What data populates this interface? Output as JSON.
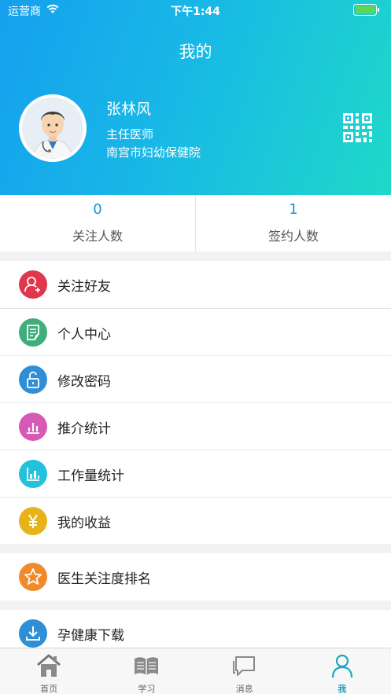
{
  "status_bar": {
    "carrier": "运营商",
    "time": "下午1:44"
  },
  "header": {
    "title": "我的"
  },
  "profile": {
    "name": "张林风",
    "title": "主任医师",
    "organization": "南宫市妇幼保健院",
    "avatar_icon": "doctor-avatar-icon",
    "qr_icon": "qr-code-icon"
  },
  "stats": [
    {
      "value": "0",
      "label": "关注人数"
    },
    {
      "value": "1",
      "label": "签约人数"
    }
  ],
  "menu_group_1": [
    {
      "label": "关注好友",
      "icon": "add-friend-icon",
      "color": "#e0364e"
    },
    {
      "label": "个人中心",
      "icon": "document-edit-icon",
      "color": "#3fae7b"
    },
    {
      "label": "修改密码",
      "icon": "unlock-icon",
      "color": "#2f8ed6"
    },
    {
      "label": "推介统计",
      "icon": "bar-chart-icon",
      "color": "#d759b6"
    },
    {
      "label": "工作量统计",
      "icon": "workload-chart-icon",
      "color": "#23c1dc"
    },
    {
      "label": "我的收益",
      "icon": "yen-icon",
      "color": "#e8b319"
    }
  ],
  "menu_group_2": [
    {
      "label": "医生关注度排名",
      "icon": "star-icon",
      "color": "#f08a2b"
    }
  ],
  "menu_group_3": [
    {
      "label": "孕健康下载",
      "icon": "download-icon",
      "color": "#2f8ed6"
    }
  ],
  "tabbar": [
    {
      "label": "首页",
      "icon": "home-icon",
      "active": false
    },
    {
      "label": "学习",
      "icon": "book-icon",
      "active": false
    },
    {
      "label": "消息",
      "icon": "chat-icon",
      "active": false
    },
    {
      "label": "我",
      "icon": "person-icon",
      "active": true
    }
  ],
  "colors": {
    "header_start": "#15a0ef",
    "header_end": "#1fd9c8",
    "accent": "#1793d6",
    "tab_active": "#1aa6c4"
  }
}
